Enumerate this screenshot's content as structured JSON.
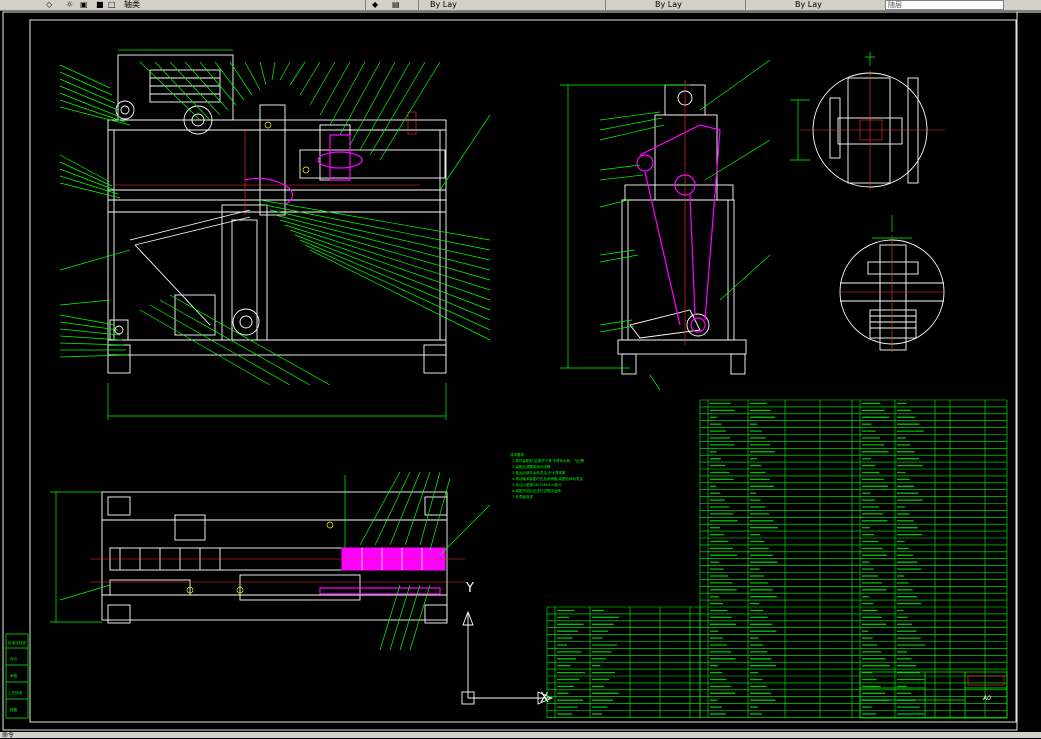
{
  "toolbar": {
    "label_1": "轴类",
    "tab_1": "By Lay",
    "tab_2": "By Lay",
    "tab_3": "By Lay",
    "field": "随层"
  },
  "title_block": {
    "sheet_size": "A0",
    "side_labels": [
      "标准化检查",
      "设计",
      "审核",
      "工艺检查",
      "描图"
    ]
  },
  "axis": {
    "y_label": "Y",
    "x_label": "X"
  },
  "status": {
    "text": "命令"
  },
  "colors": {
    "background": "#000000",
    "frame": "#ffffff",
    "linework": "#00ff00",
    "highlight": "#ff00ff",
    "centerline": "#ff3030"
  }
}
